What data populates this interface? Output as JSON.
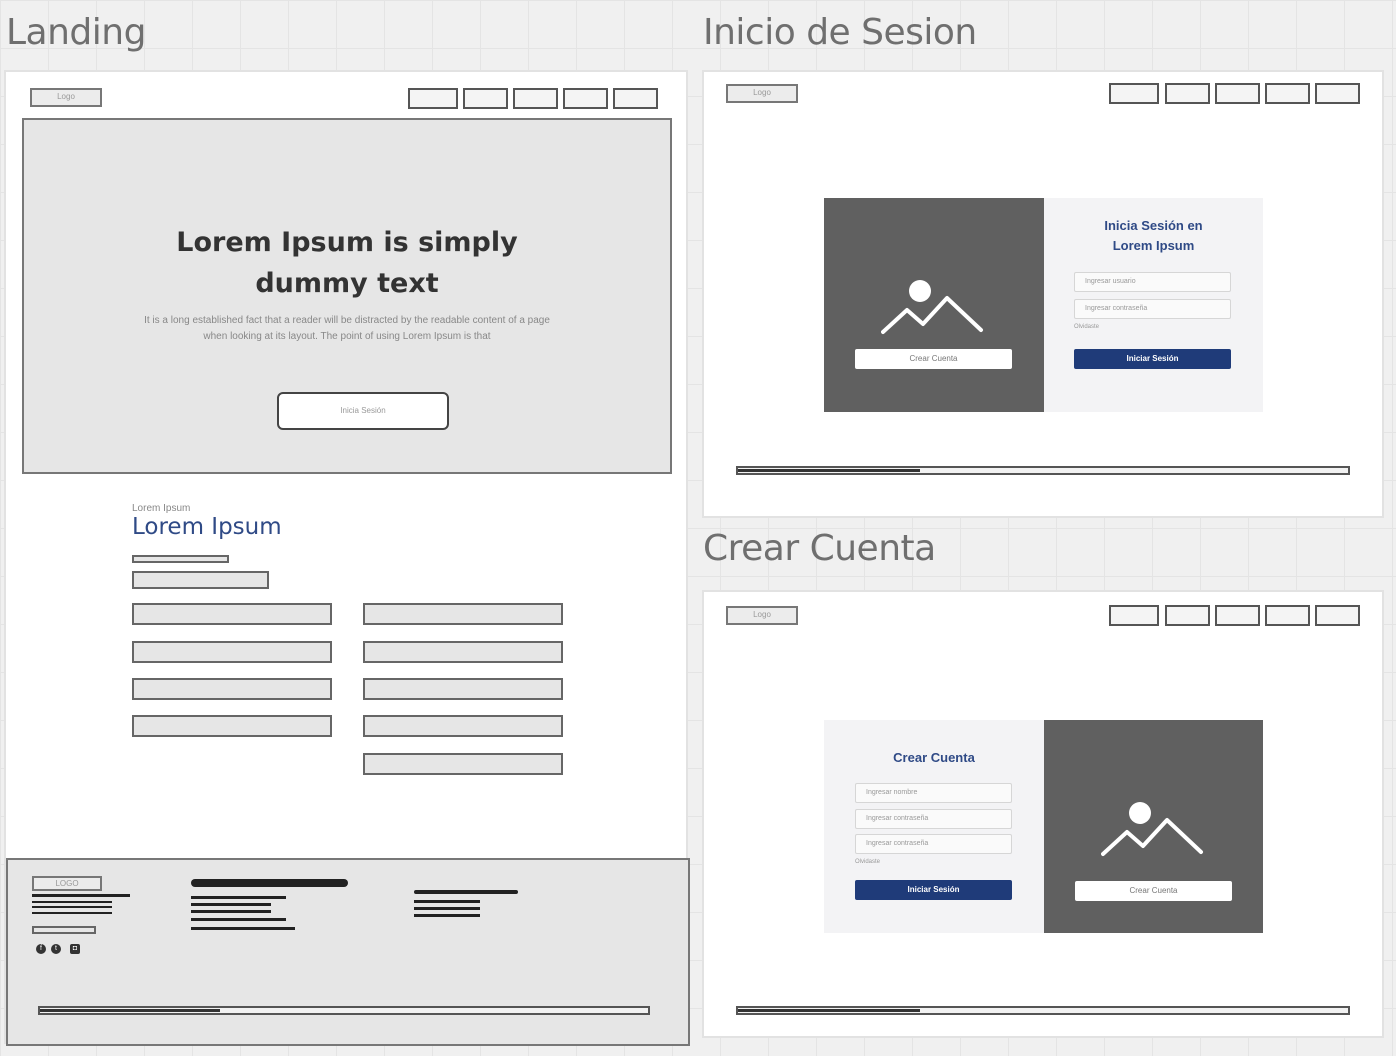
{
  "frames": {
    "landing": {
      "title": "Landing",
      "header": {
        "logo": "Logo"
      },
      "hero": {
        "title_line1": "Lorem Ipsum is simply",
        "title_line2": "dummy text",
        "text_line1": "It is a long established fact that a reader will be distracted by the readable content of a page",
        "text_line2": "when looking at its layout. The point of using Lorem Ipsum is that",
        "button": "Inicia Sesión"
      },
      "section": {
        "eyebrow": "Lorem Ipsum",
        "heading": "Lorem Ipsum"
      },
      "footer": {
        "logo": "LOGO"
      }
    },
    "login": {
      "title": "Inicio de Sesion",
      "header": {
        "logo": "Logo"
      },
      "form_title_line1": "Inicia Sesión en",
      "form_title_line2": "Lorem Ipsum",
      "username_placeholder": "Ingresar usuario",
      "password_placeholder": "Ingresar contraseña",
      "forgot": "Olvidaste",
      "submit": "Iniciar Sesión",
      "image_button": "Crear Cuenta"
    },
    "register": {
      "title": "Crear Cuenta",
      "header": {
        "logo": "Logo"
      },
      "form_title": "Crear Cuenta",
      "name_placeholder": "Ingresar nombre",
      "password_placeholder": "Ingresar contraseña",
      "confirm_placeholder": "Ingresar contraseña",
      "forgot": "Olvidaste",
      "submit": "Iniciar Sesión",
      "image_button": "Crear Cuenta"
    }
  },
  "colors": {
    "accent": "#1f3b79",
    "image_panel": "#606060",
    "canvas": "#f0f0f0"
  }
}
